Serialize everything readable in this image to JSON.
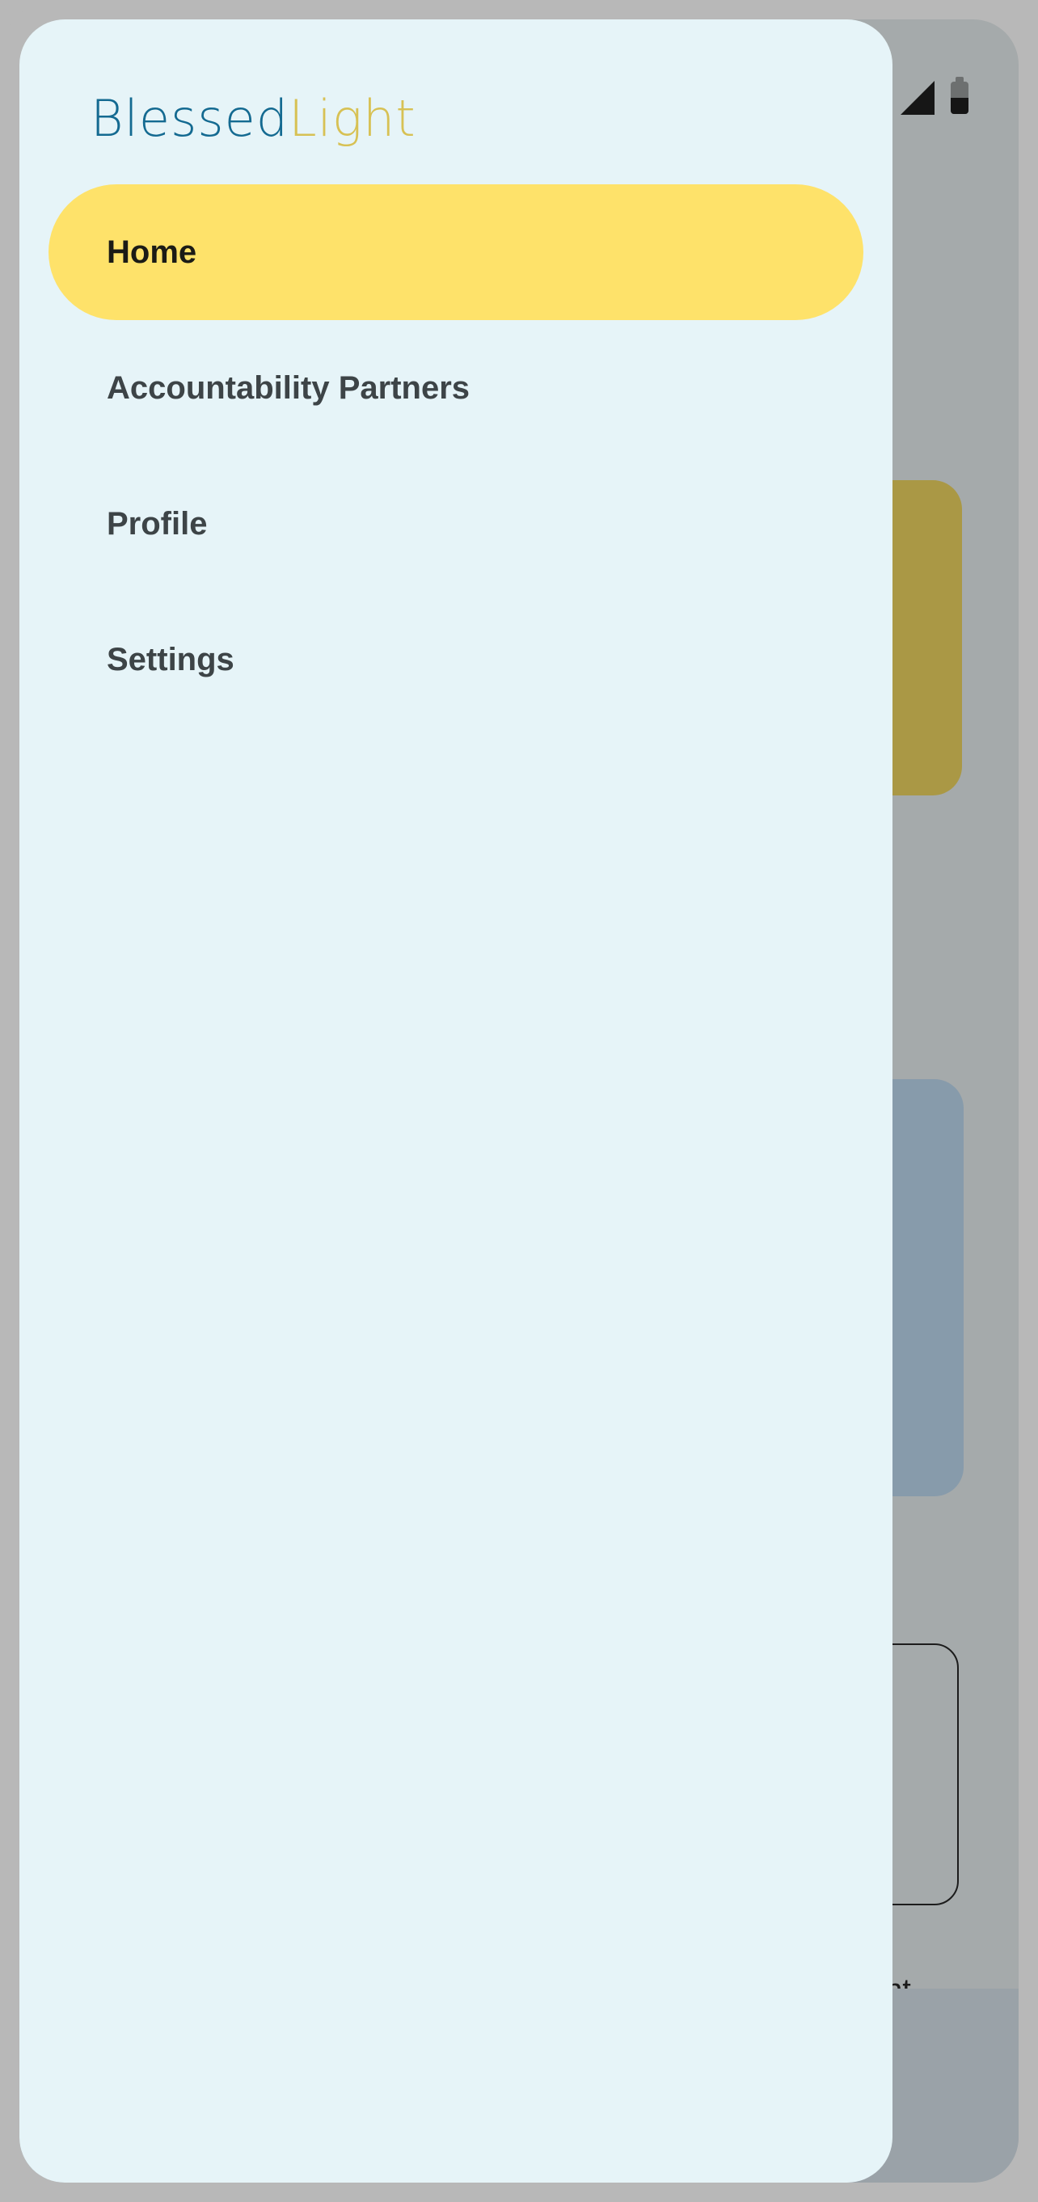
{
  "status_bar": {
    "icons": [
      "signal-icon",
      "battery-icon"
    ]
  },
  "background_screen": {
    "partial_text": "unt"
  },
  "drawer": {
    "logo": {
      "part1": "Blessed",
      "part2": "Light",
      "colors": {
        "part1": "#146a91",
        "part2": "#d7c154"
      }
    },
    "items": [
      {
        "label": "Home",
        "active": true
      },
      {
        "label": "Accountability Partners",
        "active": false
      },
      {
        "label": "Profile",
        "active": false
      },
      {
        "label": "Settings",
        "active": false
      }
    ],
    "colors": {
      "background": "#e6f4f8",
      "active_item": "#fee26a",
      "text": "#3d4447"
    }
  }
}
